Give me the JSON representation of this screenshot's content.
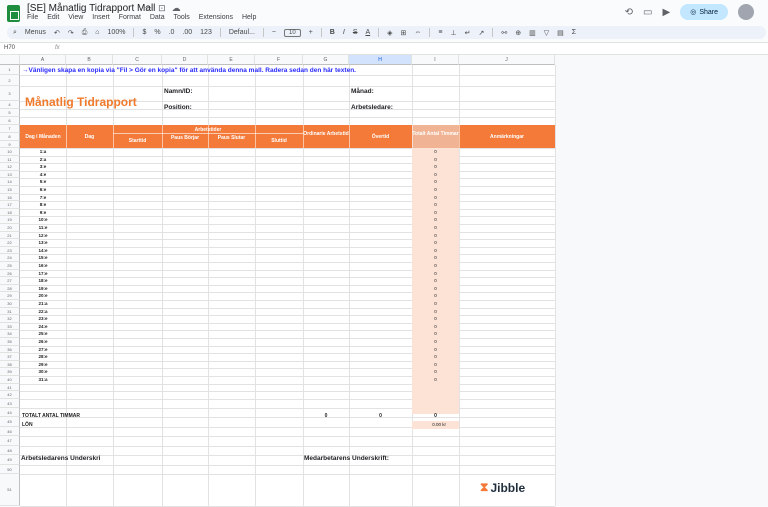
{
  "app": {
    "doc_title": "[SE] Månatlig Tidrapport Mall",
    "menu": [
      "File",
      "Edit",
      "View",
      "Insert",
      "Format",
      "Data",
      "Tools",
      "Extensions",
      "Help"
    ],
    "share_label": "Share"
  },
  "toolbar": {
    "menus_label": "Menus",
    "zoom": "100%",
    "currency": "$",
    "percent": "%",
    "decimals_less": ".0",
    "decimals_more": ".00",
    "number_format": "123",
    "font": "Defaul...",
    "font_size": "10"
  },
  "formula": {
    "cell_ref": "H70",
    "fx": "fx"
  },
  "columns": [
    "A",
    "B",
    "C",
    "D",
    "E",
    "F",
    "G",
    "H",
    "I",
    "J"
  ],
  "rows": [
    "1",
    "2",
    "3",
    "4",
    "5",
    "6",
    "7",
    "8",
    "9",
    "10",
    "11",
    "12",
    "13",
    "14",
    "15",
    "16",
    "17",
    "18",
    "19",
    "20",
    "21",
    "22",
    "23",
    "24",
    "25",
    "26",
    "27",
    "28",
    "29",
    "30",
    "31",
    "32",
    "33",
    "34",
    "35",
    "36",
    "37",
    "38",
    "39",
    "40",
    "41",
    "42",
    "43",
    "44",
    "45",
    "46",
    "47",
    "48",
    "49",
    "50",
    "51"
  ],
  "sheet": {
    "instruction": "→Vänligen skapa en kopia via \"Fil > Gör en kopia\" för att använda denna mall. Radera sedan den här texten.",
    "title": "Månatlig Tidrapport",
    "name_label": "Namn/ID:",
    "month_label": "Månad:",
    "position_label": "Position:",
    "manager_label": "Arbetsledare:",
    "headers": {
      "day_in_month": "Dag i Månaden",
      "day": "Dag",
      "worktime": "Arbetstider",
      "start": "Starttid",
      "pause_start": "Paus Börjar",
      "pause_end": "Paus Slutar",
      "end": "Sluttid",
      "ordinary": "Ordinarie Arbetstid",
      "overtime": "Övertid",
      "total": "Totalt Antal Timmar",
      "notes": "Anmärkningar"
    },
    "days": [
      "1:a",
      "2:a",
      "3:e",
      "4:e",
      "5:e",
      "6:e",
      "7:e",
      "8:e",
      "9:e",
      "10:e",
      "11:e",
      "12:e",
      "13:e",
      "14:e",
      "15:e",
      "16:e",
      "17:e",
      "18:e",
      "19:e",
      "20:e",
      "21:a",
      "22:a",
      "23:e",
      "24:e",
      "25:e",
      "26:e",
      "27:e",
      "28:e",
      "29:e",
      "30:e",
      "31:a"
    ],
    "zero": "0",
    "total_label": "TOTALT ANTAL TIMMAR",
    "total_ordinary": "0",
    "total_overtime": "0",
    "total_hours": "0",
    "wage_label": "LÖN",
    "wage_value": "0.00 kr",
    "manager_signature": "Arbetsledarens Underskri",
    "employee_signature": "Medarbetarens Underskrift:",
    "brand": "Jibble",
    "brand_mark": "𝕵"
  },
  "colors": {
    "accent": "#f47a3a",
    "peach": "#fde3d6",
    "instruction": "#2a2aff"
  }
}
